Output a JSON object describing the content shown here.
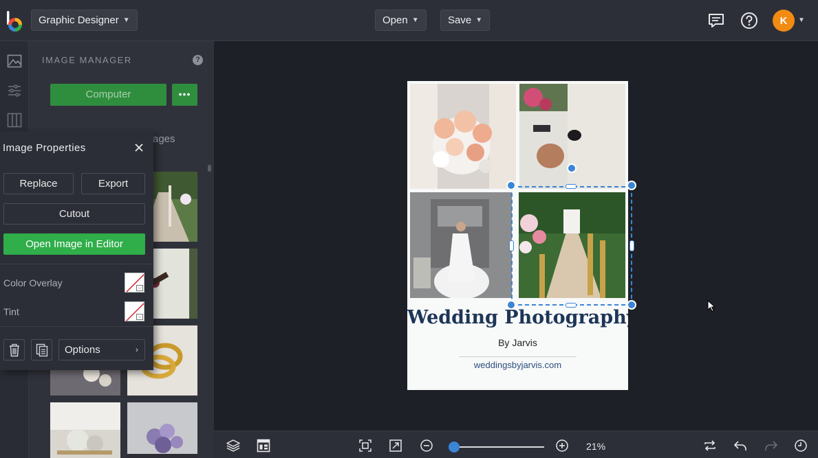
{
  "topbar": {
    "workspace_label": "Graphic Designer",
    "open_label": "Open",
    "save_label": "Save",
    "avatar_initial": "K",
    "icons": [
      "befunky-logo-icon",
      "comment-icon",
      "help-icon",
      "chevron-down-icon"
    ]
  },
  "rail": {
    "icons": [
      "image-icon",
      "adjust-icon",
      "layout-icon"
    ]
  },
  "image_manager": {
    "title": "IMAGE MANAGER",
    "help": "?",
    "computer_label": "Computer",
    "more_label": "•••",
    "tab_partial": "ages"
  },
  "image_properties": {
    "title": "Image Properties",
    "replace_label": "Replace",
    "export_label": "Export",
    "cutout_label": "Cutout",
    "open_editor_label": "Open Image in Editor",
    "color_overlay_label": "Color Overlay",
    "tint_label": "Tint",
    "options_label": "Options",
    "options_chevron": "›",
    "swatch_dropdown": "⌵"
  },
  "document": {
    "title": "Wedding Photography",
    "subtitle": "By Jarvis",
    "url": "weddingsbyjarvis.com",
    "accent": "#1d3557",
    "selection_color": "#3a85d6"
  },
  "bottombar": {
    "zoom_percent": 21,
    "zoom_label": "21%",
    "icons": [
      "layers-icon",
      "grid-icon",
      "fit-icon",
      "fullscreen-icon",
      "zoom-out-icon",
      "zoom-in-icon",
      "swap-icon",
      "undo-icon",
      "redo-icon",
      "history-icon"
    ]
  },
  "colors": {
    "green": "#2fae4a",
    "dark_bg": "#1e2028",
    "panel_bg": "#30323b",
    "avatar": "#f28b12"
  }
}
